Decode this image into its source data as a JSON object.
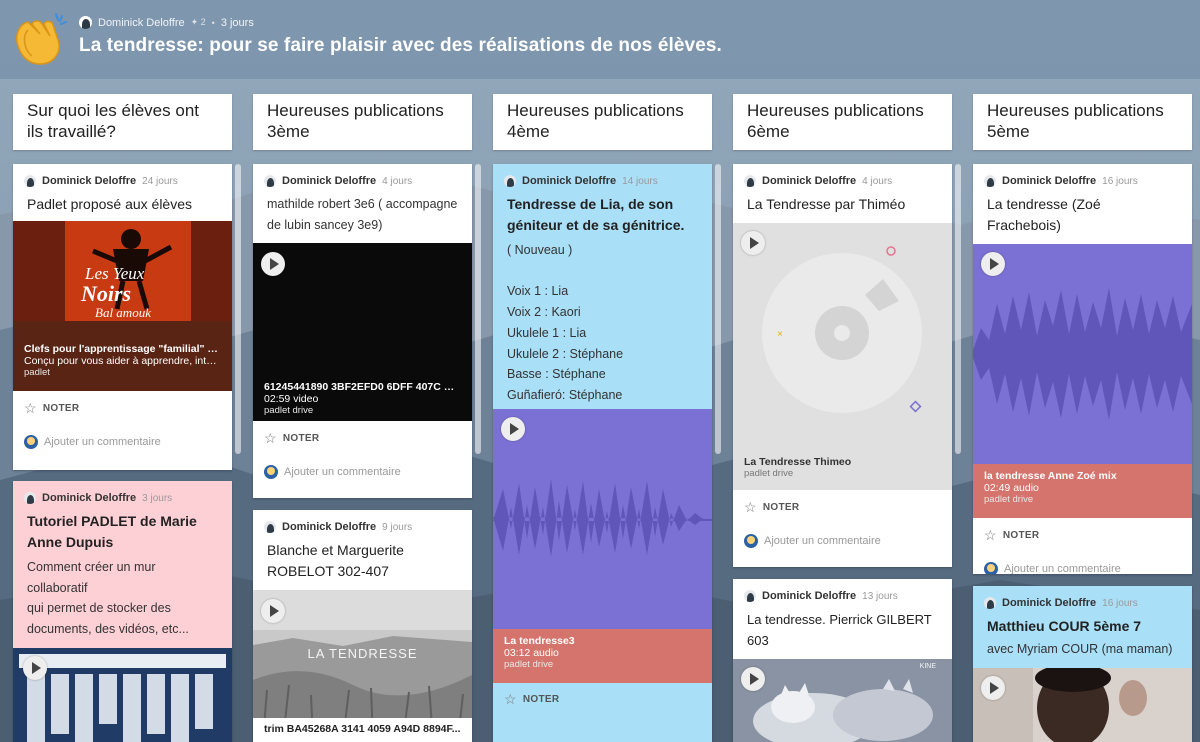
{
  "header": {
    "author": "Dominick Deloffre",
    "likes": "✦ 2",
    "age": "3 jours",
    "title": "La tendresse: pour se faire plaisir avec des réalisations de nos élèves."
  },
  "columns": [
    {
      "title": "Sur quoi les élèves ont ils travaillé?",
      "cards": [
        {
          "author": "Dominick Deloffre",
          "age": "24 jours",
          "title": "Padlet proposé aux élèves",
          "media": {
            "line1": "Clefs pour l'apprentissage \"familial\" et c...",
            "line2": "Conçu pour vous aider à apprendre, inter...",
            "line3": "padlet"
          },
          "noter": "NOTER",
          "comment": "Ajouter un commentaire"
        },
        {
          "author": "Dominick Deloffre",
          "age": "3 jours",
          "title": "Tutoriel PADLET de Marie Anne Dupuis",
          "body": [
            "Comment créer un mur collaboratif",
            "qui permet de stocker des",
            "documents, des vidéos, etc..."
          ]
        }
      ]
    },
    {
      "title": "Heureuses publications 3ème",
      "cards": [
        {
          "author": "Dominick Deloffre",
          "age": "4 jours",
          "body": [
            "mathilde robert 3e6 ( accompagne",
            "de lubin sancey 3e9)"
          ],
          "media": {
            "line1": "61245441890 3BF2EFD0 6DFF 407C BA...",
            "line2": "02:59 video",
            "line3": "padlet drive"
          },
          "noter": "NOTER",
          "comment": "Ajouter un commentaire"
        },
        {
          "author": "Dominick Deloffre",
          "age": "9 jours",
          "title": "Blanche et Marguerite ROBELOT 302-407",
          "media": {
            "overlay": "LA TENDRESSE",
            "line1": "trim BA45268A 3141 4059 A94D 8894F..."
          }
        }
      ]
    },
    {
      "title": "Heureuses publications 4ème",
      "cards": [
        {
          "author": "Dominick Deloffre",
          "age": "14 jours",
          "title": "Tendresse de Lia, de son géniteur et de sa génitrice.",
          "body": [
            "( Nouveau )",
            "",
            "Voix 1 : Lia",
            "Voix 2 : Kaori",
            "Ukulele 1 : Lia",
            "Ukulele 2 : Stéphane",
            "Basse : Stéphane",
            "Guñafieró: Stéphane"
          ],
          "media": {
            "line1": "La tendresse3",
            "line2": "03:12 audio",
            "line3": "padlet drive"
          },
          "noter": "NOTER"
        }
      ]
    },
    {
      "title": "Heureuses publications 6ème",
      "cards": [
        {
          "author": "Dominick Deloffre",
          "age": "4 jours",
          "title": "La Tendresse par Thiméo",
          "media": {
            "line1": "La Tendresse Thimeo",
            "line3": "padlet drive"
          },
          "noter": "NOTER",
          "comment": "Ajouter un commentaire"
        },
        {
          "author": "Dominick Deloffre",
          "age": "13 jours",
          "title": "La tendresse. Pierrick GILBERT 603",
          "media": {
            "watermark": "KINE"
          }
        }
      ]
    },
    {
      "title": "Heureuses publications 5ème",
      "cards": [
        {
          "author": "Dominick Deloffre",
          "age": "16 jours",
          "title": "La tendresse (Zoé Frachebois)",
          "media": {
            "line1": "la tendresse Anne Zoé mix",
            "line2": "02:49 audio",
            "line3": "padlet drive"
          },
          "noter": "NOTER",
          "comment": "Ajouter un commentaire"
        },
        {
          "author": "Dominick Deloffre",
          "age": "16 jours",
          "title": "Matthieu COUR 5ème 7",
          "body": [
            "avec Myriam COUR (ma maman)"
          ]
        }
      ]
    }
  ],
  "colors": {
    "pink": "#fdd0d6",
    "blue": "#a9dff7",
    "audio": "#7b71d4",
    "audioCaption": "#d4746d",
    "greyMedia": "#e0e0e0"
  },
  "icons": [
    "clapping-hands-icon",
    "avatar-icon",
    "star-icon",
    "play-icon",
    "comment-avatar-icon"
  ]
}
